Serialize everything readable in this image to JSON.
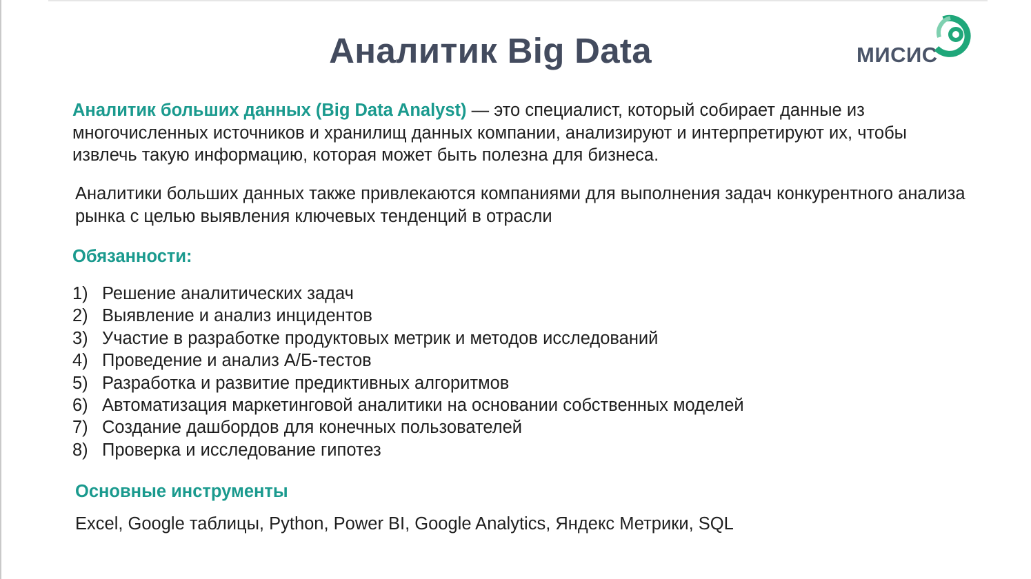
{
  "slide": {
    "title": "Аналитик Big Data",
    "logo_text": "МИСИС",
    "definition": {
      "term": "Аналитик больших данных (Big Data Analyst)",
      "text": " — это специалист, который собирает данные из многочисленных источников и хранилищ данных компании, анализируют и интерпретируют их, чтобы извлечь такую информацию, которая может быть полезна для бизнеса."
    },
    "paragraph2": "Аналитики больших данных также привлекаются компаниями для выполнения задач конкурентного анализа рынка с целью выявления ключевых тенденций в отрасли",
    "duties_heading": "Обязанности:",
    "duties": [
      {
        "num": "1)",
        "text": "Решение аналитических задач"
      },
      {
        "num": "2)",
        "text": "Выявление и анализ инцидентов"
      },
      {
        "num": "3)",
        "text": "Участие в разработке продуктовых метрик и методов исследований"
      },
      {
        "num": "4)",
        "text": "Проведение и анализ А/Б-тестов"
      },
      {
        "num": "5)",
        "text": "Разработка и развитие предиктивных алгоритмов"
      },
      {
        "num": "6)",
        "text": "Автоматизация маркетинговой аналитики на основании собственных моделей"
      },
      {
        "num": "7)",
        "text": "Создание дашбордов для конечных пользователей"
      },
      {
        "num": "8)",
        "text": "Проверка и исследование гипотез"
      }
    ],
    "tools_heading": "Основные инструменты",
    "tools": "Excel, Google таблицы, Python, Power BI, Google Analytics, Яндекс Метрики, SQL"
  },
  "colors": {
    "accent": "#1a9a8e",
    "title": "#434b5e",
    "logo_green": "#2bb673"
  }
}
